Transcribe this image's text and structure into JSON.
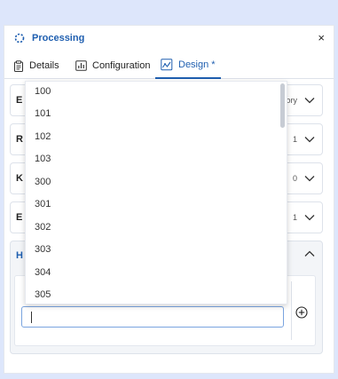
{
  "header": {
    "title": "Processing",
    "close_label": "×"
  },
  "tabs": [
    {
      "label": "Details"
    },
    {
      "label": "Configuration"
    },
    {
      "label": "Design *"
    }
  ],
  "rows": [
    {
      "label": "E",
      "value": "egory"
    },
    {
      "label": "R",
      "value": "1"
    },
    {
      "label": "K",
      "value": "0"
    },
    {
      "label": "E",
      "value": "1"
    }
  ],
  "hpanel": {
    "label": "H"
  },
  "input": {
    "value": ""
  },
  "dropdown": {
    "options": [
      "100",
      "101",
      "102",
      "103",
      "300",
      "301",
      "302",
      "303",
      "304",
      "305"
    ]
  },
  "colors": {
    "accent": "#1f5fb0",
    "background": "#dde6fb"
  }
}
